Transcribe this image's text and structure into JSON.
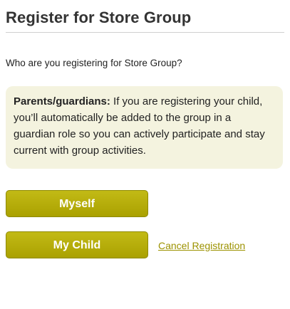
{
  "page": {
    "title": "Register for Store Group",
    "question": "Who are you registering for Store Group?"
  },
  "notice": {
    "label": "Parents/guardians:",
    "text": " If you are registering your child, you’ll automatically be added to the group in a guardian role so you can actively participate and stay current with group activities."
  },
  "actions": {
    "myself_label": "Myself",
    "child_label": "My Child",
    "cancel_label": "Cancel Registration"
  },
  "colors": {
    "button": "#b2a90a",
    "notice_bg": "#f4f3df",
    "link": "#9c9200"
  }
}
